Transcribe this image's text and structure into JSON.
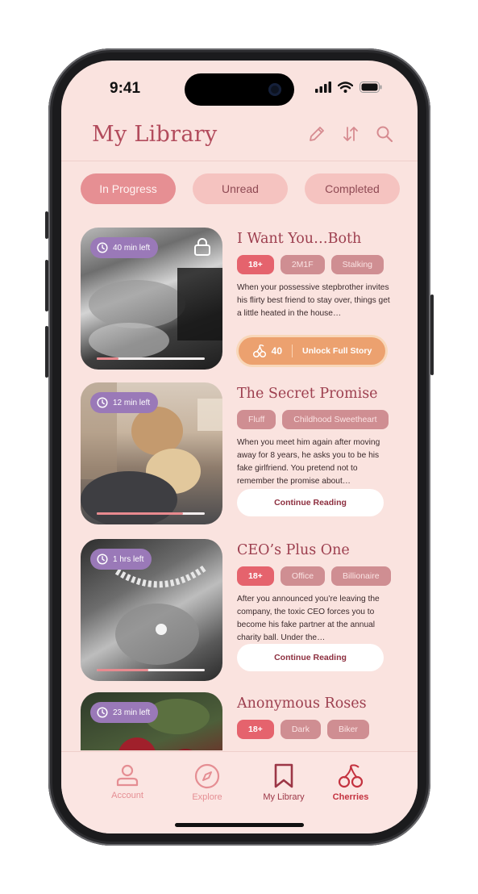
{
  "status_bar": {
    "time": "9:41"
  },
  "header": {
    "title": "My Library"
  },
  "tabs": [
    {
      "label": "In Progress",
      "active": true
    },
    {
      "label": "Unread",
      "active": false
    },
    {
      "label": "Completed",
      "active": false
    }
  ],
  "stories": [
    {
      "title": "I Want You…Both",
      "time_left": "40 min left",
      "progress": 0.2,
      "locked": true,
      "tags": [
        "18+",
        "2M1F",
        "Stalking"
      ],
      "description": "When your possessive stepbrother invites his flirty best friend to stay over, things get a little heated in the house…",
      "action": {
        "type": "unlock",
        "cherries": "40",
        "label": "Unlock Full Story"
      }
    },
    {
      "title": "The Secret Promise",
      "time_left": "12 min left",
      "progress": 0.8,
      "locked": false,
      "tags": [
        "Fluff",
        "Childhood Sweetheart"
      ],
      "description": "When you meet him again after moving away for 8 years, he asks you to be his fake girlfriend. You pretend not to remember the promise about…",
      "action": {
        "type": "continue",
        "label": "Continue Reading"
      }
    },
    {
      "title": "CEO’s Plus One",
      "time_left": "1 hrs left",
      "progress": 0.48,
      "locked": false,
      "tags": [
        "18+",
        "Office",
        "Billionaire"
      ],
      "description": "After you announced you’re leaving the company, the toxic CEO forces you to become his fake partner at the annual charity ball. Under the…",
      "action": {
        "type": "continue",
        "label": "Continue Reading"
      }
    },
    {
      "title": "Anonymous Roses",
      "time_left": "23 min left",
      "locked": false,
      "tags": [
        "18+",
        "Dark",
        "Biker"
      ]
    }
  ],
  "bottom_nav": [
    {
      "label": "Account",
      "icon": "person-icon"
    },
    {
      "label": "Explore",
      "icon": "compass-icon"
    },
    {
      "label": "My Library",
      "icon": "bookmark-icon",
      "current": true
    },
    {
      "label": "Cherries",
      "icon": "cherries-icon"
    }
  ],
  "colors": {
    "background": "#fae3df",
    "title": "#b24b5c",
    "tab_active": "#e68f93",
    "tab_inactive": "#f5c3c0",
    "tag": "#cf8e92",
    "tag_hot": "#e5636d",
    "time_pill": "#9a79b8",
    "unlock_button": "#eca16f"
  }
}
